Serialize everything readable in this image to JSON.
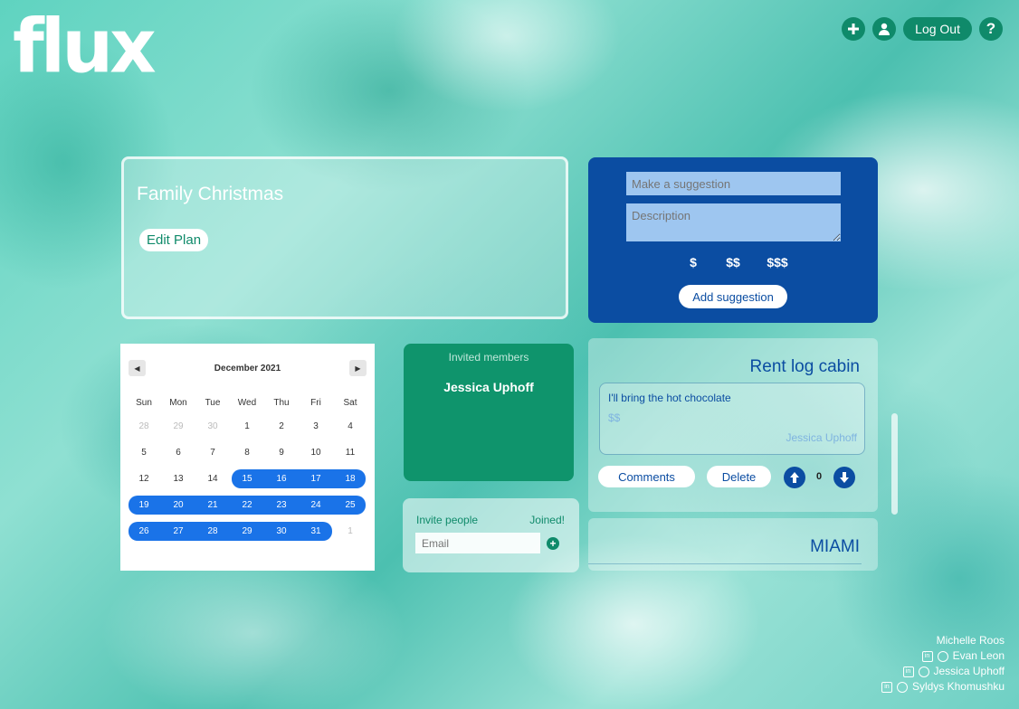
{
  "app": {
    "logo": "flux"
  },
  "topbar": {
    "add_icon": "plus-circle-icon",
    "user_icon": "user-icon",
    "logout_label": "Log Out",
    "help_icon": "question-icon"
  },
  "plan": {
    "title": "Family Christmas",
    "edit_label": "Edit Plan"
  },
  "suggestion_form": {
    "title_placeholder": "Make a suggestion",
    "description_placeholder": "Description",
    "price_options": [
      "$",
      "$$",
      "$$$"
    ],
    "submit_label": "Add suggestion"
  },
  "calendar": {
    "month": "December 2021",
    "prev_icon": "caret-left-icon",
    "next_icon": "caret-right-icon",
    "weekdays": [
      "Sun",
      "Mon",
      "Tue",
      "Wed",
      "Thu",
      "Fri",
      "Sat"
    ],
    "weeks": [
      [
        "28",
        "29",
        "30",
        "1",
        "2",
        "3",
        "4"
      ],
      [
        "5",
        "6",
        "7",
        "8",
        "9",
        "10",
        "11"
      ],
      [
        "12",
        "13",
        "14",
        "15",
        "16",
        "17",
        "18"
      ],
      [
        "19",
        "20",
        "21",
        "22",
        "23",
        "24",
        "25"
      ],
      [
        "26",
        "27",
        "28",
        "29",
        "30",
        "31",
        "1"
      ]
    ],
    "selected_range": [
      "15",
      "31"
    ]
  },
  "invited": {
    "title": "Invited members",
    "members": [
      "Jessica Uphoff"
    ]
  },
  "invite": {
    "label": "Invite people",
    "joined_label": "Joined!",
    "email_placeholder": "Email"
  },
  "suggestions": [
    {
      "title": "Rent log cabin",
      "description": "I'll bring the hot chocolate",
      "price": "$$",
      "author": "Jessica Uphoff",
      "comments_label": "Comments",
      "delete_label": "Delete",
      "votes": "0"
    },
    {
      "title": "MIAMI"
    }
  ],
  "credits": [
    "Michelle Roos",
    "Evan Leon",
    "Jessica Uphoff",
    "Syldys Khomushku"
  ],
  "colors": {
    "green": "#0f8a6a",
    "blue": "#0b4da2",
    "selection": "#1a73e8"
  }
}
